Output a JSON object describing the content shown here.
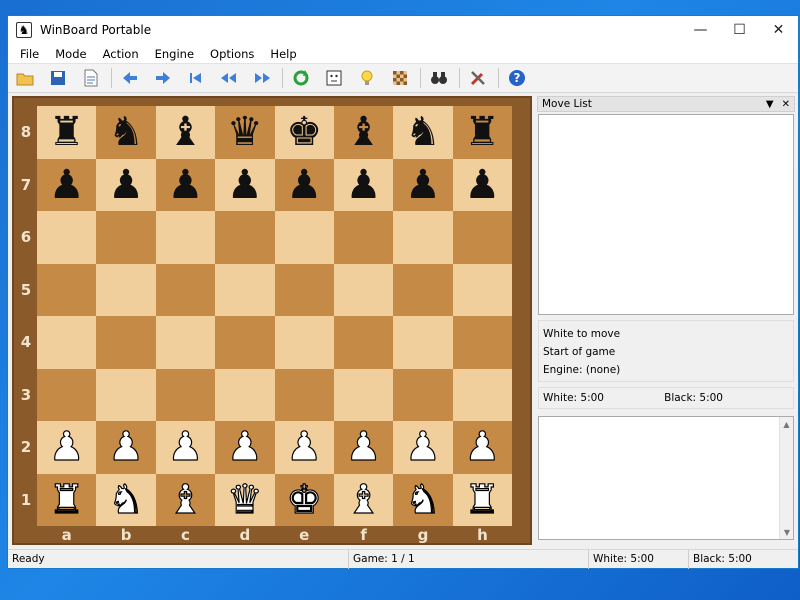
{
  "window": {
    "title": "WinBoard Portable"
  },
  "menu": [
    "File",
    "Mode",
    "Action",
    "Engine",
    "Options",
    "Help"
  ],
  "toolbar": [
    "open-icon",
    "save-icon",
    "document-icon",
    "arrow-left-icon",
    "arrow-right-icon",
    "to-start-icon",
    "rewind-icon",
    "fast-forward-icon",
    "refresh-icon",
    "face-icon",
    "lightbulb-icon",
    "board-icon",
    "binoculars-icon",
    "tools-icon",
    "help-icon"
  ],
  "board": {
    "ranks": [
      "8",
      "7",
      "6",
      "5",
      "4",
      "3",
      "2",
      "1"
    ],
    "files": [
      "a",
      "b",
      "c",
      "d",
      "e",
      "f",
      "g",
      "h"
    ],
    "position": [
      [
        "r",
        "n",
        "b",
        "q",
        "k",
        "b",
        "n",
        "r"
      ],
      [
        "p",
        "p",
        "p",
        "p",
        "p",
        "p",
        "p",
        "p"
      ],
      [
        "",
        "",
        "",
        "",
        "",
        "",
        "",
        ""
      ],
      [
        "",
        "",
        "",
        "",
        "",
        "",
        "",
        ""
      ],
      [
        "",
        "",
        "",
        "",
        "",
        "",
        "",
        ""
      ],
      [
        "",
        "",
        "",
        "",
        "",
        "",
        "",
        ""
      ],
      [
        "P",
        "P",
        "P",
        "P",
        "P",
        "P",
        "P",
        "P"
      ],
      [
        "R",
        "N",
        "B",
        "Q",
        "K",
        "B",
        "N",
        "R"
      ]
    ]
  },
  "panel": {
    "move_list_title": "Move List",
    "info": [
      "White to move",
      "Start of game",
      "Engine: (none)"
    ],
    "white_clock": "White:   5:00",
    "black_clock": "Black:   5:00"
  },
  "status": {
    "ready": "Ready",
    "game": "Game:  1 / 1",
    "white": "White: 5:00",
    "black": "Black: 5:00"
  }
}
